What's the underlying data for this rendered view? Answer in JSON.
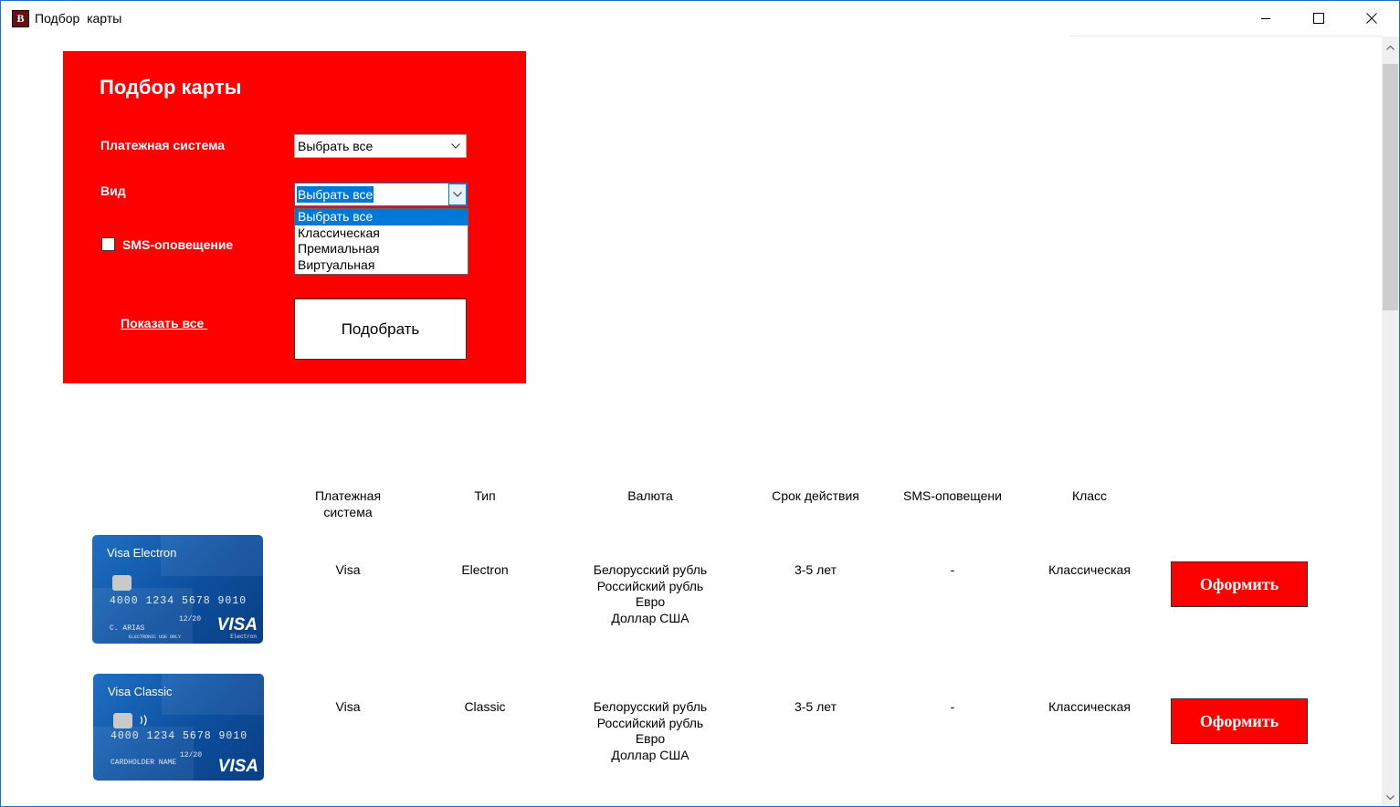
{
  "window": {
    "title": "Подбор  карты",
    "icon_letter": "B"
  },
  "form": {
    "title": "Подбор карты",
    "payment_system_label": "Платежная система",
    "payment_system_value": "Выбрать все",
    "kind_label": "Вид",
    "kind_value": "Выбрать все",
    "kind_options": [
      "Выбрать все",
      "Классическая",
      "Премиальная",
      "Виртуальная"
    ],
    "kind_selected_index": 0,
    "sms_label": "SMS-оповещение",
    "sms_checked": false,
    "show_all_link": "Показать все ",
    "pick_button": "Подобрать"
  },
  "table": {
    "headers": [
      "Платежная\nсистема",
      "Тип",
      "Валюта",
      "Срок действия",
      "SMS-оповещени",
      "Класс"
    ],
    "rows": [
      {
        "card": {
          "name": "Visa Electron",
          "number": "4000 1234 5678 9010",
          "expiry": "12/20",
          "holder": "C. ARIAS",
          "note": "ELECTRONIC USE ONLY",
          "brand": "VISA",
          "brand_sub": "Electron"
        },
        "system": "Visa",
        "type": "Electron",
        "currencies": [
          "Белорусский рубль",
          "Российский рубль",
          "Евро",
          "Доллар США"
        ],
        "term": "3-5 лет",
        "sms": "-",
        "class": "Классическая",
        "button": "Оформить"
      },
      {
        "card": {
          "name": "Visa Classic",
          "number": "4000 1234 5678 9010",
          "expiry": "12/20",
          "holder": "CARDHOLDER NAME",
          "note": "",
          "brand": "VISA",
          "brand_sub": ""
        },
        "system": "Visa",
        "type": "Classic",
        "currencies": [
          "Белорусский рубль",
          "Российский рубль",
          "Евро",
          "Доллар США"
        ],
        "term": "3-5 лет",
        "sms": "-",
        "class": "Классическая",
        "button": "Оформить"
      }
    ]
  }
}
